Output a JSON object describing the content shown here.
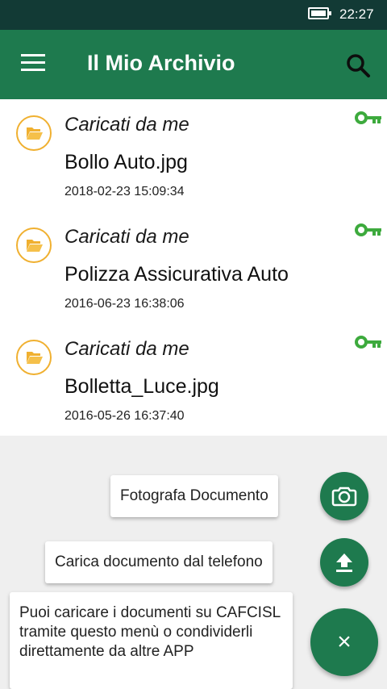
{
  "status_bar": {
    "time": "22:27"
  },
  "app_bar": {
    "title": "Il Mio Archivio"
  },
  "files": [
    {
      "owner": "Caricati da me",
      "name": "Bollo Auto.jpg",
      "date": "2018-02-23 15:09:34"
    },
    {
      "owner": "Caricati da me",
      "name": "Polizza Assicurativa Auto",
      "date": "2016-06-23 16:38:06"
    },
    {
      "owner": "Caricati da me",
      "name": "Bolletta_Luce.jpg",
      "date": "2016-05-26 16:37:40"
    }
  ],
  "fab_menu": {
    "photo_label": "Fotografa Documento",
    "upload_label": "Carica documento dal telefono",
    "close_symbol": "×"
  },
  "hint": {
    "text": "Puoi caricare i documenti su CAFCISL tramite questo menù o condividerli direttamente da altre APP"
  },
  "colors": {
    "status_bar": "#123a35",
    "primary": "#1e7a4e",
    "accent_key": "#3daa3d",
    "folder": "#f0b030",
    "overlay": "#efefef"
  },
  "icons": {
    "menu": "menu-icon",
    "search": "search-icon",
    "folder": "folder-open-icon",
    "key": "key-icon",
    "camera": "camera-icon",
    "upload": "upload-icon",
    "close": "close-icon",
    "battery": "battery-icon"
  }
}
